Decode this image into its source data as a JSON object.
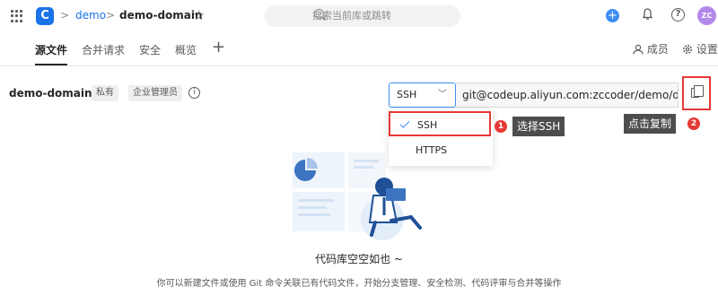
{
  "header": {
    "breadcrumb_repo": "demo",
    "breadcrumb_current": "demo-domain",
    "search_placeholder": "搜索当前库或跳转",
    "avatar_initials": "ZC"
  },
  "tabs": [
    {
      "label": "源文件",
      "active": true
    },
    {
      "label": "合并请求"
    },
    {
      "label": "安全"
    },
    {
      "label": "概览"
    }
  ],
  "tab_actions": {
    "members_label": "成员",
    "settings_label": "设置"
  },
  "repo": {
    "name": "demo-domain",
    "badge_private": "私有",
    "badge_role": "企业管理员"
  },
  "clone": {
    "protocol_selected": "SSH",
    "url": "git@codeup.aliyun.com:zccoder/demo/demo",
    "options": [
      "SSH",
      "HTTPS"
    ]
  },
  "annotations": {
    "step1_number": "1",
    "step1_text": "选择SSH",
    "step2_number": "2",
    "step2_text": "点击复制"
  },
  "empty_state": {
    "title": "代码库空空如也 ~",
    "description": "你可以新建文件或使用 Git 命令关联已有代码文件，开始分支管理、安全检测、代码评审与合并等操作"
  },
  "colors": {
    "accent": "#1b73e8",
    "highlight": "#e53935",
    "callout_bg": "#4d4d4d"
  }
}
